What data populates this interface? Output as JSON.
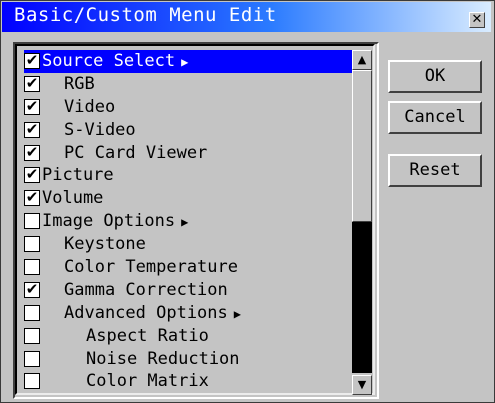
{
  "window": {
    "title": "Basic/Custom Menu Edit",
    "close_glyph": "✕"
  },
  "list": {
    "items": [
      {
        "label": "Source Select",
        "checked": true,
        "indent": 0,
        "submenu": true,
        "selected": true
      },
      {
        "label": "RGB",
        "checked": true,
        "indent": 1,
        "submenu": false,
        "selected": false
      },
      {
        "label": "Video",
        "checked": true,
        "indent": 1,
        "submenu": false,
        "selected": false
      },
      {
        "label": "S-Video",
        "checked": true,
        "indent": 1,
        "submenu": false,
        "selected": false
      },
      {
        "label": "PC Card Viewer",
        "checked": true,
        "indent": 1,
        "submenu": false,
        "selected": false
      },
      {
        "label": "Picture",
        "checked": true,
        "indent": 0,
        "submenu": false,
        "selected": false
      },
      {
        "label": "Volume",
        "checked": true,
        "indent": 0,
        "submenu": false,
        "selected": false
      },
      {
        "label": "Image Options",
        "checked": false,
        "indent": 0,
        "submenu": true,
        "selected": false
      },
      {
        "label": "Keystone",
        "checked": false,
        "indent": 1,
        "submenu": false,
        "selected": false
      },
      {
        "label": "Color Temperature",
        "checked": false,
        "indent": 1,
        "submenu": false,
        "selected": false
      },
      {
        "label": "Gamma Correction",
        "checked": true,
        "indent": 1,
        "submenu": false,
        "selected": false
      },
      {
        "label": "Advanced Options",
        "checked": false,
        "indent": 1,
        "submenu": true,
        "selected": false
      },
      {
        "label": "Aspect Ratio",
        "checked": false,
        "indent": 2,
        "submenu": false,
        "selected": false
      },
      {
        "label": "Noise Reduction",
        "checked": false,
        "indent": 2,
        "submenu": false,
        "selected": false
      },
      {
        "label": "Color Matrix",
        "checked": false,
        "indent": 2,
        "submenu": false,
        "selected": false
      }
    ],
    "checkmark_glyph": "✔",
    "submenu_glyph": "▶",
    "scroll_up_glyph": "▲",
    "scroll_down_glyph": "▼"
  },
  "buttons": {
    "ok": "OK",
    "cancel": "Cancel",
    "reset": "Reset"
  }
}
